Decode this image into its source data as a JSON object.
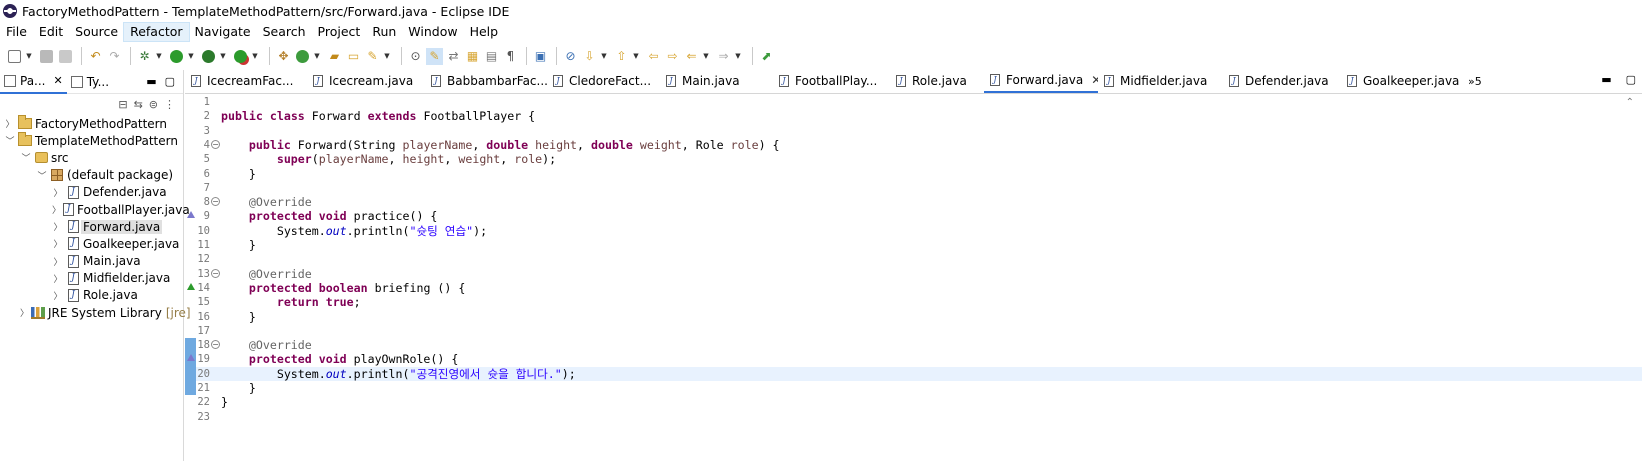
{
  "window": {
    "title": "FactoryMethodPattern - TemplateMethodPattern/src/Forward.java - Eclipse IDE"
  },
  "menu": [
    "File",
    "Edit",
    "Source",
    "Refactor",
    "Navigate",
    "Search",
    "Project",
    "Run",
    "Window",
    "Help"
  ],
  "left_panel": {
    "tabs": [
      {
        "label": "Pa..."
      },
      {
        "label": "Ty..."
      }
    ],
    "tree": [
      {
        "label": "FactoryMethodPattern",
        "icon": "project-folder-icon"
      },
      {
        "label": "TemplateMethodPattern",
        "icon": "project-folder-icon"
      },
      {
        "label": "src",
        "icon": "source-folder-icon"
      },
      {
        "label": "(default package)",
        "icon": "package-icon"
      },
      {
        "label": "Defender.java",
        "icon": "java-file-icon"
      },
      {
        "label": "FootballPlayer.java",
        "icon": "java-abstract-file-icon"
      },
      {
        "label": "Forward.java",
        "icon": "java-file-icon"
      },
      {
        "label": "Goalkeeper.java",
        "icon": "java-file-icon"
      },
      {
        "label": "Main.java",
        "icon": "java-file-icon"
      },
      {
        "label": "Midfielder.java",
        "icon": "java-file-icon"
      },
      {
        "label": "Role.java",
        "icon": "java-enum-file-icon"
      },
      {
        "label": "JRE System Library",
        "extra": "[jre]",
        "icon": "library-icon"
      }
    ]
  },
  "editor": {
    "tabs": [
      "IcecreamFac...",
      "Icecream.java",
      "BabbambarFac...",
      "CledoreFact...",
      "Main.java",
      "FootballPlay...",
      "Role.java",
      "Forward.java",
      "Midfielder.java",
      "Defender.java",
      "Goalkeeper.java"
    ],
    "active_tab": "Forward.java",
    "overflow": "»5",
    "lines": [
      {
        "n": "1",
        "text": ""
      },
      {
        "n": "2",
        "text": "public class Forward extends FootballPlayer {"
      },
      {
        "n": "3",
        "text": ""
      },
      {
        "n": "4",
        "text": "    public Forward(String playerName, double height, double weight, Role role) {"
      },
      {
        "n": "5",
        "text": "        super(playerName, height, weight, role);"
      },
      {
        "n": "6",
        "text": "    }"
      },
      {
        "n": "7",
        "text": ""
      },
      {
        "n": "8",
        "text": "    @Override"
      },
      {
        "n": "9",
        "text": "    protected void practice() {"
      },
      {
        "n": "10",
        "text": "        System.out.println(\"슛팅 연습\");"
      },
      {
        "n": "11",
        "text": "    }"
      },
      {
        "n": "12",
        "text": ""
      },
      {
        "n": "13",
        "text": "    @Override"
      },
      {
        "n": "14",
        "text": "    protected boolean briefing () {"
      },
      {
        "n": "15",
        "text": "        return true;"
      },
      {
        "n": "16",
        "text": "    }"
      },
      {
        "n": "17",
        "text": ""
      },
      {
        "n": "18",
        "text": "    @Override"
      },
      {
        "n": "19",
        "text": "    protected void playOwnRole() {"
      },
      {
        "n": "20",
        "text": "        System.out.println(\"공격진영에서 슛을 합니다.\");"
      },
      {
        "n": "21",
        "text": "    }"
      },
      {
        "n": "22",
        "text": "}"
      },
      {
        "n": "23",
        "text": ""
      }
    ]
  }
}
